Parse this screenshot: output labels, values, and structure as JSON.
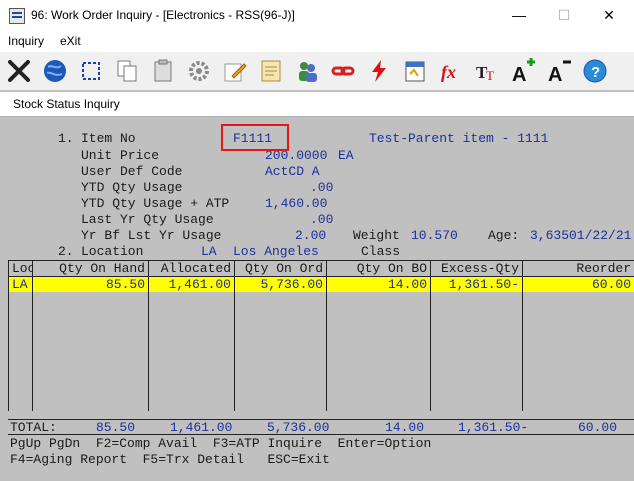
{
  "window": {
    "title": "96: Work Order Inquiry - [Electronics - RSS(96-J)]",
    "minimize": "—",
    "maximize": "☐",
    "close": "✕"
  },
  "menu": {
    "inquiry": "Inquiry",
    "exit": "eXit"
  },
  "toolbar": {
    "items": [
      "close-icon",
      "globe-icon",
      "select-icon",
      "copy-icon",
      "paste-icon",
      "settings-icon",
      "edit-icon",
      "notes-icon",
      "users-icon",
      "link-icon",
      "lightning-icon",
      "calendar-icon",
      "function-icon",
      "font-size-icon",
      "font-increase-icon",
      "font-decrease-icon",
      "help-icon"
    ]
  },
  "panel": {
    "title": "Stock Status Inquiry"
  },
  "item": {
    "num1": "1.",
    "item_no_label": "Item No",
    "item_no": "F1111",
    "description": "Test-Parent item - 1111",
    "unit_price_label": "Unit Price",
    "unit_price": "200.0000",
    "uom": "EA",
    "user_def_label": "User Def Code",
    "user_def": "ActCD A",
    "ytd_label": "YTD Qty Usage",
    "ytd": ".00",
    "ytd_atp_label": "YTD Qty Usage + ATP",
    "ytd_atp": "1,460.00",
    "last_yr_label": "Last Yr Qty Usage",
    "last_yr": ".00",
    "yr_bf_label": "Yr Bf Lst Yr Usage",
    "yr_bf": "2.00",
    "weight_label": "Weight",
    "weight": "10.570",
    "age_label": "Age:",
    "age": "3,63501/22/21",
    "num2": "2.",
    "location_label": "Location",
    "location_code": "LA",
    "location_name": "Los Angeles",
    "class_label": "Class"
  },
  "table": {
    "headers": [
      "Loc",
      "Qty On Hand",
      "Allocated",
      "Qty On Ord",
      "Qty On BO",
      "Excess-Qty",
      "Reorder"
    ],
    "row": [
      "LA",
      "85.50",
      "1,461.00",
      "5,736.00",
      "14.00",
      "1,361.50-",
      "60.00"
    ],
    "total_label": "TOTAL:",
    "totals": [
      "85.50",
      "1,461.00",
      "5,736.00",
      "14.00",
      "1,361.50-",
      "60.00"
    ]
  },
  "footer": {
    "line1": "PgUp PgDn  F2=Comp Avail  F3=ATP Inquire  Enter=Option",
    "line2": "F4=Aging Report  F5=Trx Detail   ESC=Exit"
  }
}
